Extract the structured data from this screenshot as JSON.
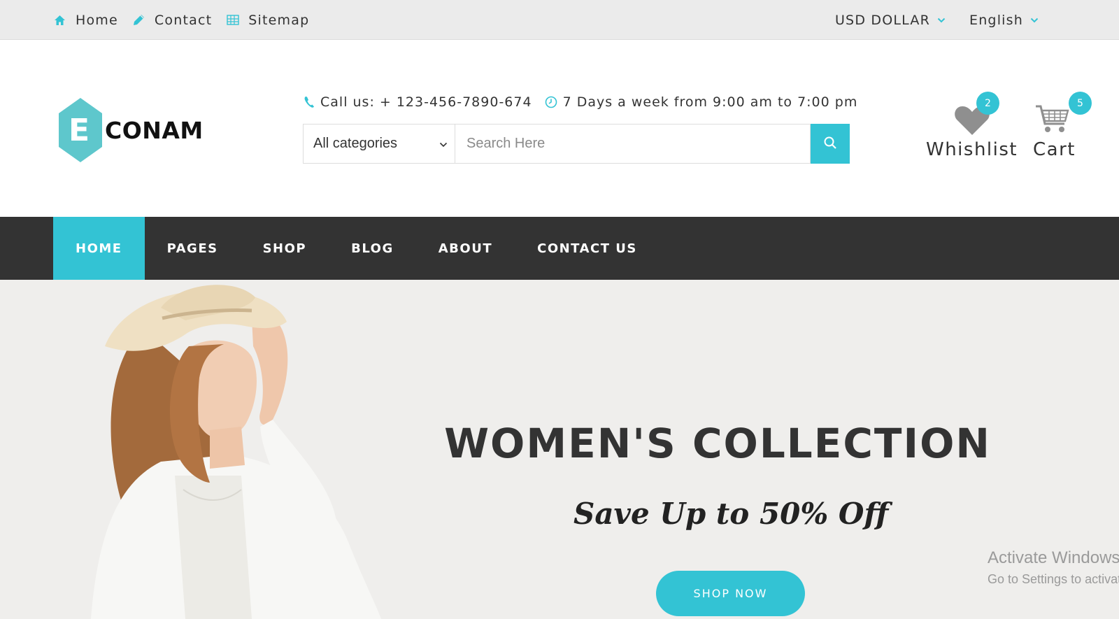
{
  "topbar": {
    "links": [
      {
        "label": "Home",
        "icon": "home-icon"
      },
      {
        "label": "Contact",
        "icon": "pencil-icon"
      },
      {
        "label": "Sitemap",
        "icon": "sitemap-icon"
      }
    ],
    "currency": "USD DOLLAR",
    "language": "English"
  },
  "header": {
    "logo": {
      "letter": "E",
      "text": "CONAM"
    },
    "phone": "Call us: + 123-456-7890-674",
    "hours": "7 Days a week from 9:00 am to 7:00 pm",
    "search": {
      "category": "All categories",
      "placeholder": "Search Here"
    },
    "wishlist": {
      "label": "Whishlist",
      "count": "2"
    },
    "cart": {
      "label": "Cart",
      "count": "5"
    }
  },
  "nav": {
    "items": [
      "HOME",
      "PAGES",
      "SHOP",
      "BLOG",
      "ABOUT",
      "CONTACT US"
    ],
    "active": "HOME"
  },
  "hero": {
    "title": "WOMEN'S COLLECTION",
    "subtitle": "Save Up to 50% Off",
    "button": "SHOP NOW"
  },
  "watermark": {
    "title": "Activate Windows",
    "subtitle": "Go to Settings to activate Windows."
  },
  "colors": {
    "accent": "#33c3d4",
    "nav_bg": "#333333",
    "topbar_bg": "#ebebeb",
    "hero_bg": "#efeeec"
  }
}
